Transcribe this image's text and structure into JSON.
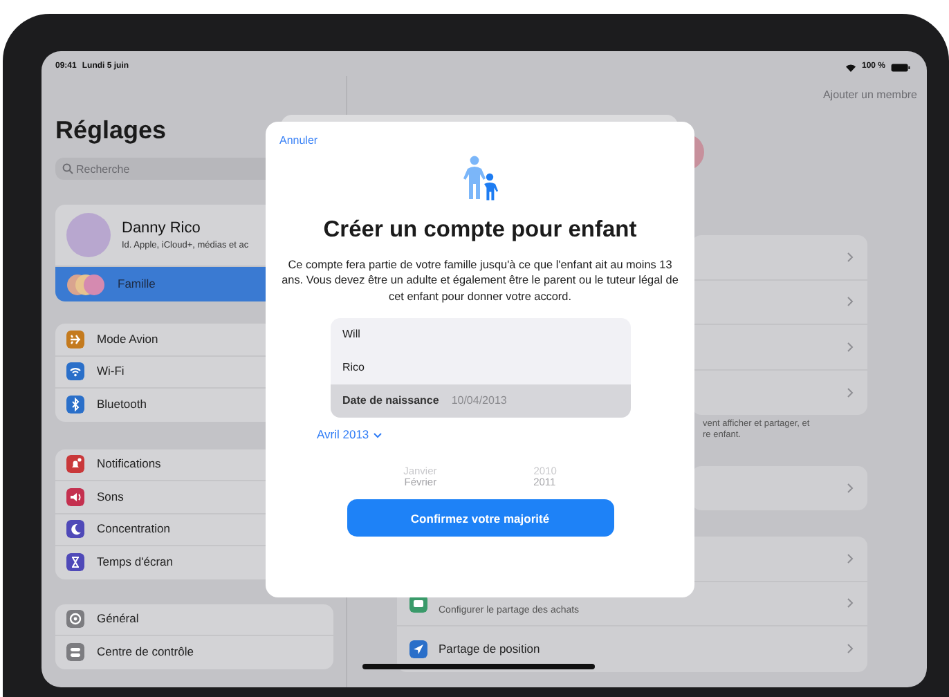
{
  "status_bar": {
    "time": "09:41",
    "date": "Lundi 5 juin",
    "battery": "100 %"
  },
  "sidebar": {
    "title": "Réglages",
    "search": {
      "placeholder": "Recherche"
    },
    "profile": {
      "name": "Danny Rico",
      "subtitle": "Id. Apple, iCloud+, médias et ac"
    },
    "account_items": [
      {
        "label": "Famille",
        "selected": true
      }
    ],
    "groups": [
      [
        {
          "label": "Mode Avion",
          "kind": "plane",
          "color": "#c47a1e",
          "selected": false
        },
        {
          "label": "Wi-Fi",
          "kind": "wifi",
          "color": "#2a6fc9",
          "selected": false
        },
        {
          "label": "Bluetooth",
          "kind": "bluetooth",
          "color": "#2a6fc9",
          "selected": false
        }
      ],
      [
        {
          "label": "Notifications",
          "kind": "bell",
          "color": "#c9383a",
          "selected": false
        },
        {
          "label": "Sons",
          "kind": "speaker",
          "color": "#c4304f",
          "selected": false
        },
        {
          "label": "Concentration",
          "kind": "moon",
          "color": "#4f49b8",
          "selected": false
        },
        {
          "label": "Temps d'écran",
          "kind": "hourglass",
          "color": "#4f49b8",
          "selected": false
        }
      ],
      [
        {
          "label": "Général",
          "kind": "gear",
          "color": "#7c7c80",
          "selected": false
        },
        {
          "label": "Centre de contrôle",
          "kind": "toggles",
          "color": "#7c7c80",
          "selected": false
        }
      ]
    ]
  },
  "detail": {
    "action": "Ajouter un membre",
    "groups": [
      {
        "rows": [
          {
            "kind": "blank"
          },
          {
            "kind": "blank"
          },
          {
            "kind": "blank"
          },
          {
            "kind": "blank"
          }
        ],
        "footnote": [
          "vent afficher et partager, et",
          "re enfant."
        ]
      },
      {
        "rows": [
          {
            "kind": "blank"
          }
        ]
      },
      {
        "rows": [
          {
            "kind": "blank"
          },
          {
            "kind": "card",
            "color": "#3a9a6a",
            "subtitle": "Configurer le partage des achats"
          },
          {
            "kind": "location",
            "color": "#2a6fc9",
            "title": "Partage de position"
          }
        ]
      }
    ]
  },
  "modal": {
    "cancel": "Annuler",
    "title": "Créer un compte pour enfant",
    "message": "Ce compte fera partie de votre famille jusqu'à ce que l'enfant ait au moins 13 ans. Vous devez être un adulte et également être le parent ou le tuteur légal de cet enfant pour donner votre accord.",
    "fields": [
      {
        "kind": "text",
        "value": "Will",
        "selected": false
      },
      {
        "kind": "text",
        "value": "Rico",
        "selected": false
      },
      {
        "kind": "date",
        "label": "Date de naissance",
        "value": "10/04/2013",
        "selected": true
      }
    ],
    "month_picker": "Avril 2013",
    "wheel": [
      {
        "month": "Janvier",
        "year": "2010"
      },
      {
        "month": "Février",
        "year": "2011"
      }
    ],
    "confirm": "Confirmez votre majorité"
  }
}
